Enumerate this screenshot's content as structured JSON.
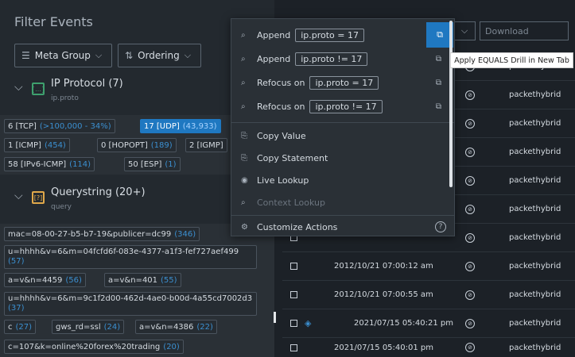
{
  "filter_panel": {
    "title": "Filter Events",
    "meta_group_label": "Meta Group",
    "ordering_label": "Ordering",
    "groups": [
      {
        "title": "IP Protocol (7)",
        "key": "ip.proto",
        "values": [
          {
            "label": "6 [TCP]",
            "count": "(>100,000 - 34%)"
          },
          {
            "label": "17 [UDP]",
            "count": "(43,933)",
            "active": true
          },
          {
            "label": "1 [ICMP]",
            "count": "(454)"
          },
          {
            "label": "0 [HOPOPT]",
            "count": "(189)"
          },
          {
            "label": "2 [IGMP]",
            "count": ""
          },
          {
            "label": "58 [IPv6-ICMP]",
            "count": "(114)"
          },
          {
            "label": "50 [ESP]",
            "count": "(1)"
          }
        ]
      },
      {
        "title": "Querystring (20+)",
        "key": "query",
        "values": [
          {
            "label": "mac=08-00-27-b5-b7-19&publicer=dc99",
            "count": "(346)"
          },
          {
            "label": "u=hhhh&v=6&m=04fcfd6f-083e-4377-a1f3-fef727aef499",
            "count": "(57)"
          },
          {
            "label": "a=v&n=4459",
            "count": "(56)"
          },
          {
            "label": "a=v&n=401",
            "count": "(55)"
          },
          {
            "label": "u=hhhh&v=6&m=9c1f2d00-462d-4ae0-b00d-4a55cd7002d3",
            "count": "(37)"
          },
          {
            "label": "c",
            "count": "(27)"
          },
          {
            "label": "gws_rd=ssl",
            "count": "(24)"
          },
          {
            "label": "a=v&n=4386",
            "count": "(22)"
          },
          {
            "label": "c=107&k=online%20forex%20trading",
            "count": "(20)"
          }
        ]
      }
    ]
  },
  "toolbar": {
    "download_label": "Download"
  },
  "context_menu": {
    "items": [
      {
        "icon": "search-icon",
        "action": "Append",
        "expr": "ip.proto = 17"
      },
      {
        "icon": "search-icon",
        "action": "Append",
        "expr": "ip.proto != 17"
      },
      {
        "icon": "search-icon",
        "action": "Refocus on",
        "expr": "ip.proto = 17"
      },
      {
        "icon": "search-icon",
        "action": "Refocus on",
        "expr": "ip.proto != 17"
      }
    ],
    "copy_value": "Copy Value",
    "copy_statement": "Copy Statement",
    "live_lookup": "Live Lookup",
    "context_lookup": "Context Lookup",
    "customize_actions": "Customize Actions",
    "tooltip": "Apply EQUALS Drill in New Tab"
  },
  "events": [
    {
      "time": "",
      "service": "packethybrid"
    },
    {
      "time": "",
      "service": "packethybrid"
    },
    {
      "time": "",
      "service": "packethybrid"
    },
    {
      "time": "",
      "service": "packethybrid"
    },
    {
      "time": "",
      "service": "packethybrid"
    },
    {
      "time": "",
      "service": "packethybrid"
    },
    {
      "time": "",
      "service": "packethybrid"
    },
    {
      "time": "2012/10/21 07:00:12 am",
      "service": "packethybrid"
    },
    {
      "time": "2012/10/21 07:00:55 am",
      "service": "packethybrid"
    },
    {
      "time": "2021/07/15 05:40:21 pm",
      "service": "packethybrid",
      "has_stack": true
    },
    {
      "time": "2021/07/15 05:40:01 pm",
      "service": "packethybrid"
    }
  ],
  "colors": {
    "accent": "#1f78c1",
    "ip_group_icon": "#3ea06e",
    "query_group_icon": "#e0a84a"
  }
}
